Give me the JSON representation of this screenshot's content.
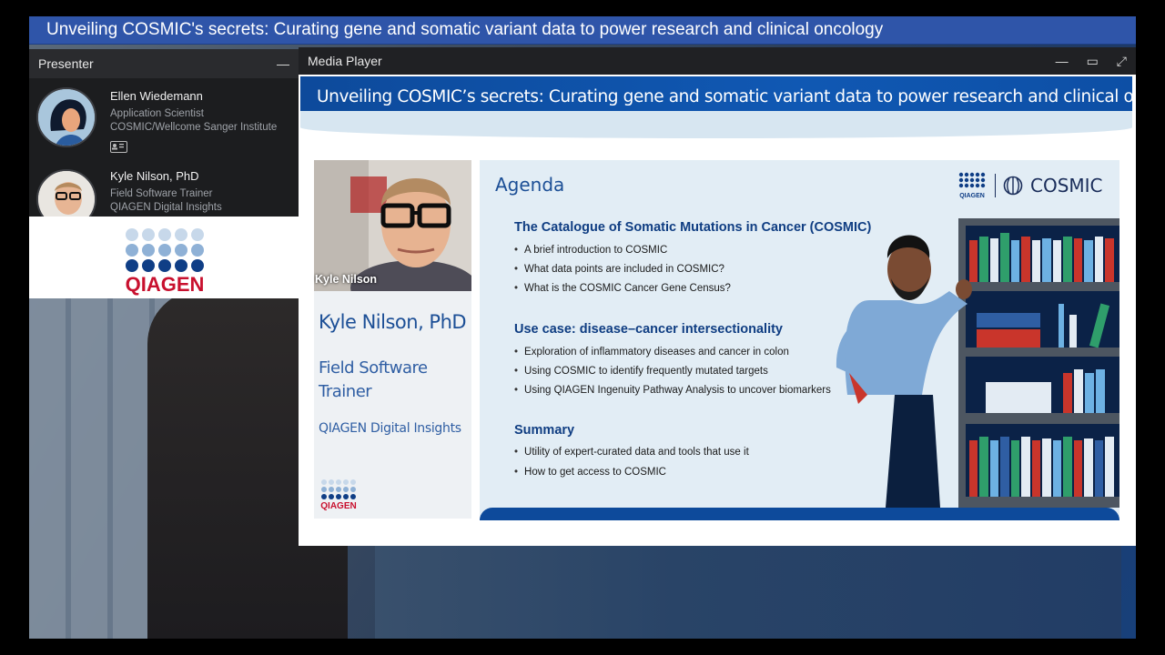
{
  "event": {
    "title": "Unveiling COSMIC's secrets: Curating gene and somatic variant data to power research and clinical oncology"
  },
  "presenter_panel": {
    "header": "Presenter",
    "minimize": "—",
    "presenters": [
      {
        "name": "Ellen Wiedemann",
        "role": "Application Scientist",
        "org": "COSMIC/Wellcome Sanger Institute"
      },
      {
        "name": "Kyle Nilson, PhD",
        "role": "Field Software Trainer",
        "org": "QIAGEN Digital Insights"
      }
    ]
  },
  "sponsor_logo": {
    "text": "QIAGEN"
  },
  "media_player": {
    "header": "Media Player",
    "controls": {
      "minimize": "—",
      "maximize": "▭",
      "fullscreen": "⤢"
    },
    "slide": {
      "title": "Unveiling COSMIC’s secrets: Curating gene and somatic variant data to power research and clinical oncology",
      "camera_label": "Kyle Nilson",
      "speaker_name": "Kyle Nilson, PhD",
      "speaker_role": "Field Software Trainer",
      "speaker_org": "QIAGEN Digital Insights",
      "qiagen_small": "QIAGEN",
      "agenda_title": "Agenda",
      "logo_qiagen": "QIAGEN",
      "logo_cosmic": "COSMIC",
      "sections": [
        {
          "heading": "The Catalogue of Somatic Mutations in Cancer (COSMIC)",
          "bullets": [
            "A brief introduction to COSMIC",
            "What data points are included in COSMIC?",
            "What is the COSMIC Cancer Gene Census?"
          ]
        },
        {
          "heading": "Use case: disease–cancer intersectionality",
          "bullets": [
            "Exploration of inflammatory diseases and cancer in colon",
            "Using COSMIC to identify frequently mutated targets",
            "Using QIAGEN Ingenuity Pathway Analysis to uncover biomarkers"
          ]
        },
        {
          "heading": "Summary",
          "bullets": [
            "Utility of expert-curated data and tools that use it",
            "How to get access to COSMIC"
          ]
        }
      ]
    }
  },
  "colors": {
    "title_bar": "#2f55a9",
    "slide_blue": "#0d4a9b",
    "qiagen_red": "#c8102e"
  }
}
